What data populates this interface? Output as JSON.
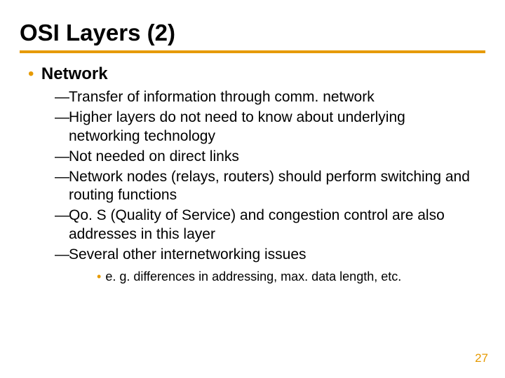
{
  "title": "OSI Layers (2)",
  "section": {
    "heading": "Network",
    "items": [
      "Transfer of information through comm. network",
      "Higher layers do not need to know about underlying networking technology",
      "Not needed on direct links",
      "Network nodes (relays, routers) should perform switching and routing functions",
      "Qo. S (Quality of Service) and congestion control are also addresses in this layer",
      "Several other internetworking issues"
    ],
    "subitems": [
      "e. g. differences in addressing, max. data length, etc."
    ]
  },
  "page_number": "27",
  "colors": {
    "accent": "#e69a00"
  }
}
